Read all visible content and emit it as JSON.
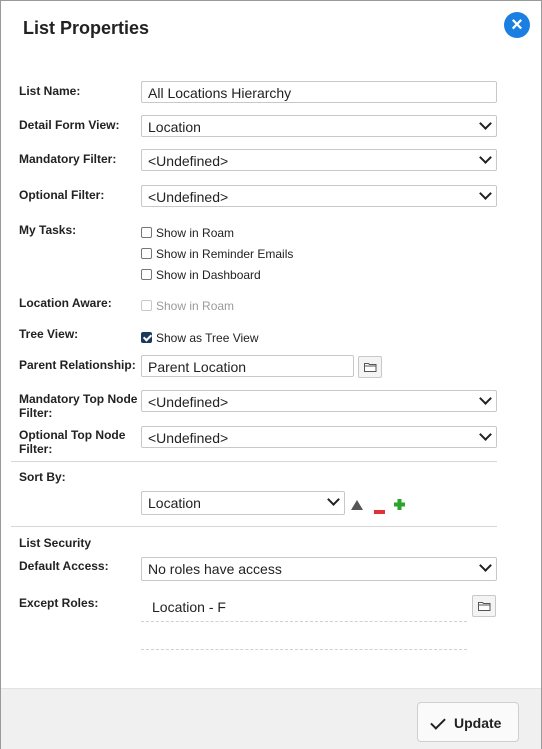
{
  "dialog": {
    "title": "List Properties",
    "close_icon": "close-icon"
  },
  "fields": {
    "list_name": {
      "label": "List Name:",
      "value": "All Locations Hierarchy"
    },
    "detail_form_view": {
      "label": "Detail Form View:",
      "value": "Location"
    },
    "mandatory_filter": {
      "label": "Mandatory Filter:",
      "value": "<Undefined>"
    },
    "optional_filter": {
      "label": "Optional Filter:",
      "value": "<Undefined>"
    },
    "my_tasks": {
      "label": "My Tasks:",
      "options": [
        {
          "label": "Show in Roam",
          "checked": false
        },
        {
          "label": "Show in Reminder Emails",
          "checked": false
        },
        {
          "label": "Show in Dashboard",
          "checked": false
        }
      ]
    },
    "location_aware": {
      "label": "Location Aware:",
      "option": "Show in Roam",
      "checked": false,
      "disabled": true
    },
    "tree_view": {
      "label": "Tree View:",
      "option": "Show as Tree View",
      "checked": true
    },
    "parent_relationship": {
      "label": "Parent Relationship:",
      "value": "Parent Location"
    },
    "mandatory_top_node_filter": {
      "label_line1": "Mandatory Top Node",
      "label_line2": "Filter:",
      "value": "<Undefined>"
    },
    "optional_top_node_filter": {
      "label_line1": "Optional Top Node",
      "label_line2": "Filter:",
      "value": "<Undefined>"
    },
    "sort_by": {
      "label": "Sort By:",
      "value": "Location"
    }
  },
  "security": {
    "heading": "List Security",
    "default_access": {
      "label": "Default Access:",
      "value": "No roles have access"
    },
    "except_roles": {
      "label": "Except Roles:",
      "roles": [
        "Location - F"
      ]
    }
  },
  "footer": {
    "update_label": "Update"
  },
  "colors": {
    "accent": "#1a7fe0",
    "remove": "#e0303a",
    "add": "#2aa52a",
    "checked": "#1a3a5c"
  }
}
